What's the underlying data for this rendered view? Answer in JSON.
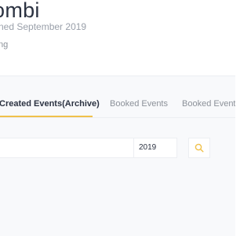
{
  "profile": {
    "name": "ombi",
    "joined": "ned September 2019",
    "role": "ng"
  },
  "tabs": [
    {
      "label": "Created Events(Archive)",
      "active": true
    },
    {
      "label": "Booked Events",
      "active": false
    },
    {
      "label": "Booked Events",
      "active": false
    }
  ],
  "filters": {
    "year_value": "2019",
    "search_icon": "search-icon"
  },
  "colors": {
    "accent": "#f0c14b",
    "title_text": "#2c3342",
    "muted_text": "#9aa0aa",
    "panel_bg": "#f8f9fb"
  }
}
